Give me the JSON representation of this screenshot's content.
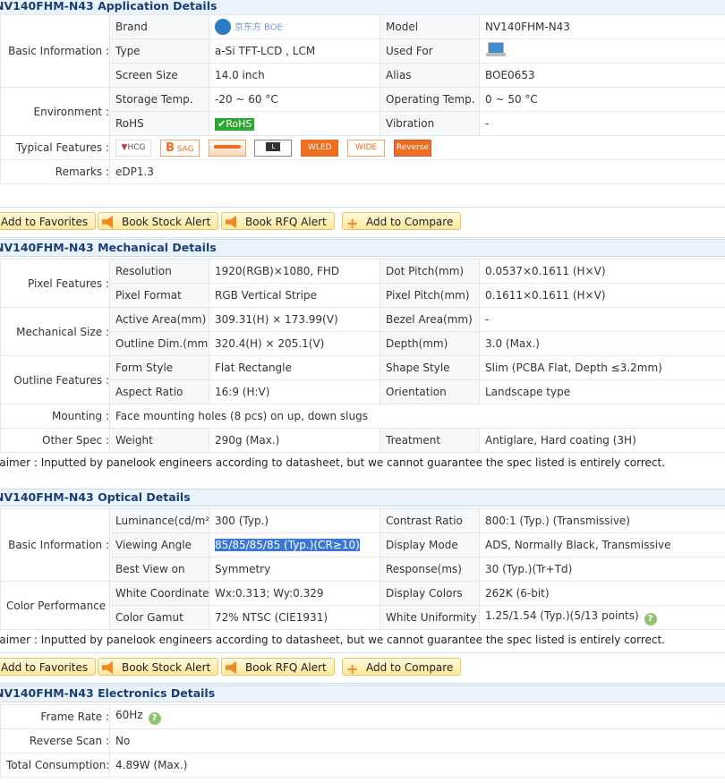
{
  "application": {
    "header": "NV140FHM-N43 Application Details",
    "rows": [
      {
        "cat": "Basic Information :",
        "c1": "Brand",
        "v1": "京东方 BOE",
        "c2": "Model",
        "v2": "NV140FHM-N43"
      },
      {
        "c1": "Type",
        "v1": "a-Si TFT-LCD , LCM",
        "c2": "Used For",
        "v2": "laptop-icon"
      },
      {
        "c1": "Screen Size",
        "v1": "14.0 inch",
        "c2": "Alias",
        "v2": "BOE0653"
      },
      {
        "cat": "Environment :",
        "c1": "Storage Temp.",
        "v1": "-20 ~ 60 °C",
        "c2": "Operating Temp.",
        "v2": "0 ~ 50 °C"
      },
      {
        "c1": "RoHS",
        "v1": "RoHS",
        "c2": "Vibration",
        "v2": "-"
      }
    ],
    "features_label": "Typical Features :",
    "features": [
      "HCG",
      "SAG",
      "",
      "L",
      "WLED",
      "WIDE",
      "Reverse"
    ],
    "remarks_label": "Remarks :",
    "remarks": "eDP1.3"
  },
  "buttons": {
    "favorites": "Add to Favorites",
    "stock": "Book Stock Alert",
    "rfq": "Book RFQ Alert",
    "compare": "Add to Compare"
  },
  "mechanical": {
    "header": "NV140FHM-N43 Mechanical Details",
    "pixel": {
      "cat": "Pixel Features :",
      "r1": [
        "Resolution",
        "1920(RGB)×1080, FHD",
        "Dot Pitch(mm)",
        "0.0537×0.1611 (H×V)"
      ],
      "r2": [
        "Pixel Format",
        "RGB Vertical Stripe",
        "Pixel Pitch(mm)",
        "0.1611×0.1611 (H×V)"
      ]
    },
    "size": {
      "cat": "Mechanical Size :",
      "r1": [
        "Active Area(mm)",
        "309.31(H) × 173.99(V)",
        "Bezel Area(mm)",
        "-"
      ],
      "r2": [
        "Outline Dim.(mm)",
        "320.4(H) × 205.1(V)",
        "Depth(mm)",
        "3.0 (Max.)"
      ]
    },
    "outline": {
      "cat": "Outline Features :",
      "r1": [
        "Form Style",
        "Flat Rectangle",
        "Shape Style",
        "Slim (PCBA Flat, Depth ≤3.2mm)"
      ],
      "r2": [
        "Aspect Ratio",
        "16:9 (H:V)",
        "Orientation",
        "Landscape type"
      ]
    },
    "mounting": {
      "cat": "Mounting :",
      "value": "Face mounting holes (8 pcs) on up, down slugs"
    },
    "other": {
      "cat": "Other Spec :",
      "r1": [
        "Weight",
        "290g (Max.)",
        "Treatment",
        "Antiglare, Hard coating (3H)"
      ]
    },
    "disclaimer": "laimer : Inputted by panelook engineers according to datasheet, but we cannot guarantee the spec listed is entirely correct."
  },
  "optical": {
    "header": "NV140FHM-N43 Optical Details",
    "basic": {
      "cat": "Basic Information :",
      "r1": [
        "Luminance(cd/m²)",
        "300 (Typ.)",
        "Contrast Ratio",
        "800:1 (Typ.) (Transmissive)"
      ],
      "r2": [
        "Viewing Angle",
        "85/85/85/85 (Typ.)(CR≥10)",
        "Display Mode",
        "ADS, Normally Black, Transmissive"
      ],
      "r3": [
        "Best View on",
        "Symmetry",
        "Response(ms)",
        "30 (Typ.)(Tr+Td)"
      ]
    },
    "color": {
      "cat": "Color Performance :",
      "r1": [
        "White Coordinate",
        "Wx:0.313; Wy:0.329",
        "Display Colors",
        "262K (6-bit)"
      ],
      "r2": [
        "Color Gamut",
        "72% NTSC (CIE1931)",
        "White Uniformity",
        "1.25/1.54 (Typ.)(5/13 points)"
      ]
    },
    "disclaimer": "laimer : Inputted by panelook engineers according to datasheet, but we cannot guarantee the spec listed is entirely correct."
  },
  "electronics": {
    "header": "NV140FHM-N43 Electronics Details",
    "rows": [
      [
        "Frame Rate :",
        "60Hz"
      ],
      [
        "Reverse Scan :",
        "No"
      ],
      [
        "Total Consumption:",
        "4.89W (Max.)"
      ]
    ]
  }
}
